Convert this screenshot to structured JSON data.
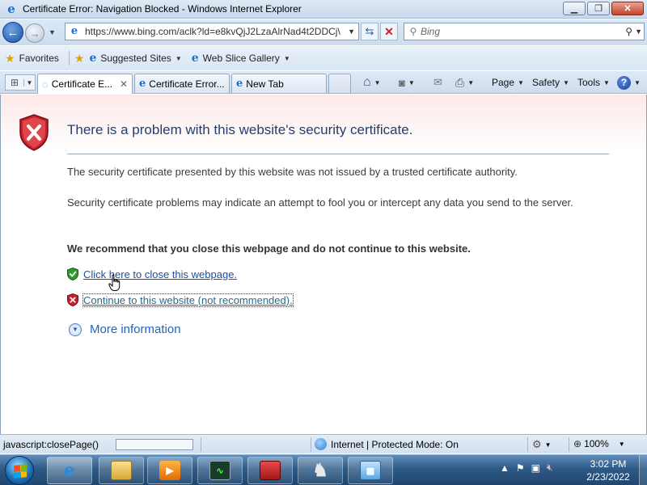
{
  "window": {
    "title": "Certificate Error: Navigation Blocked - Windows Internet Explorer",
    "minimize": "▁",
    "maximize": "❐",
    "close": "✕"
  },
  "address_bar": {
    "url": "https://www.bing.com/aclk?ld=e8kvQjJ2LzaAlrNad4t2DDCj\\",
    "search_placeholder": "Bing"
  },
  "favorites_bar": {
    "favorites_label": "Favorites",
    "items": [
      {
        "label": "Suggested Sites"
      },
      {
        "label": "Web Slice Gallery"
      }
    ]
  },
  "tabs": [
    {
      "label": "Certificate E...",
      "active": true
    },
    {
      "label": "Certificate Error...",
      "active": false
    },
    {
      "label": "New Tab",
      "active": false
    }
  ],
  "command_bar": {
    "page": "Page",
    "safety": "Safety",
    "tools": "Tools",
    "help": "?"
  },
  "content": {
    "title": "There is a problem with this website's security certificate.",
    "paragraph1": "The security certificate presented by this website was not issued by a trusted certificate authority.",
    "paragraph2": "Security certificate problems may indicate an attempt to fool you or intercept any data you send to the server.",
    "recommendation": "We recommend that you close this webpage and do not continue to this website.",
    "close_link": "Click here to close this webpage.",
    "continue_link": "Continue to this website (not recommended).",
    "more_info": "More information"
  },
  "status_bar": {
    "text": "javascript:closePage()",
    "progress": 0.0,
    "zone": "Internet | Protected Mode: On",
    "zoom": "100%"
  },
  "taskbar": {
    "time": "3:02 PM",
    "date": "2/23/2022"
  },
  "colors": {
    "title_blue": "#1f3f73",
    "link_blue": "#1d4fa0",
    "error_red": "#c8202a",
    "safe_green": "#2f9a2f"
  }
}
